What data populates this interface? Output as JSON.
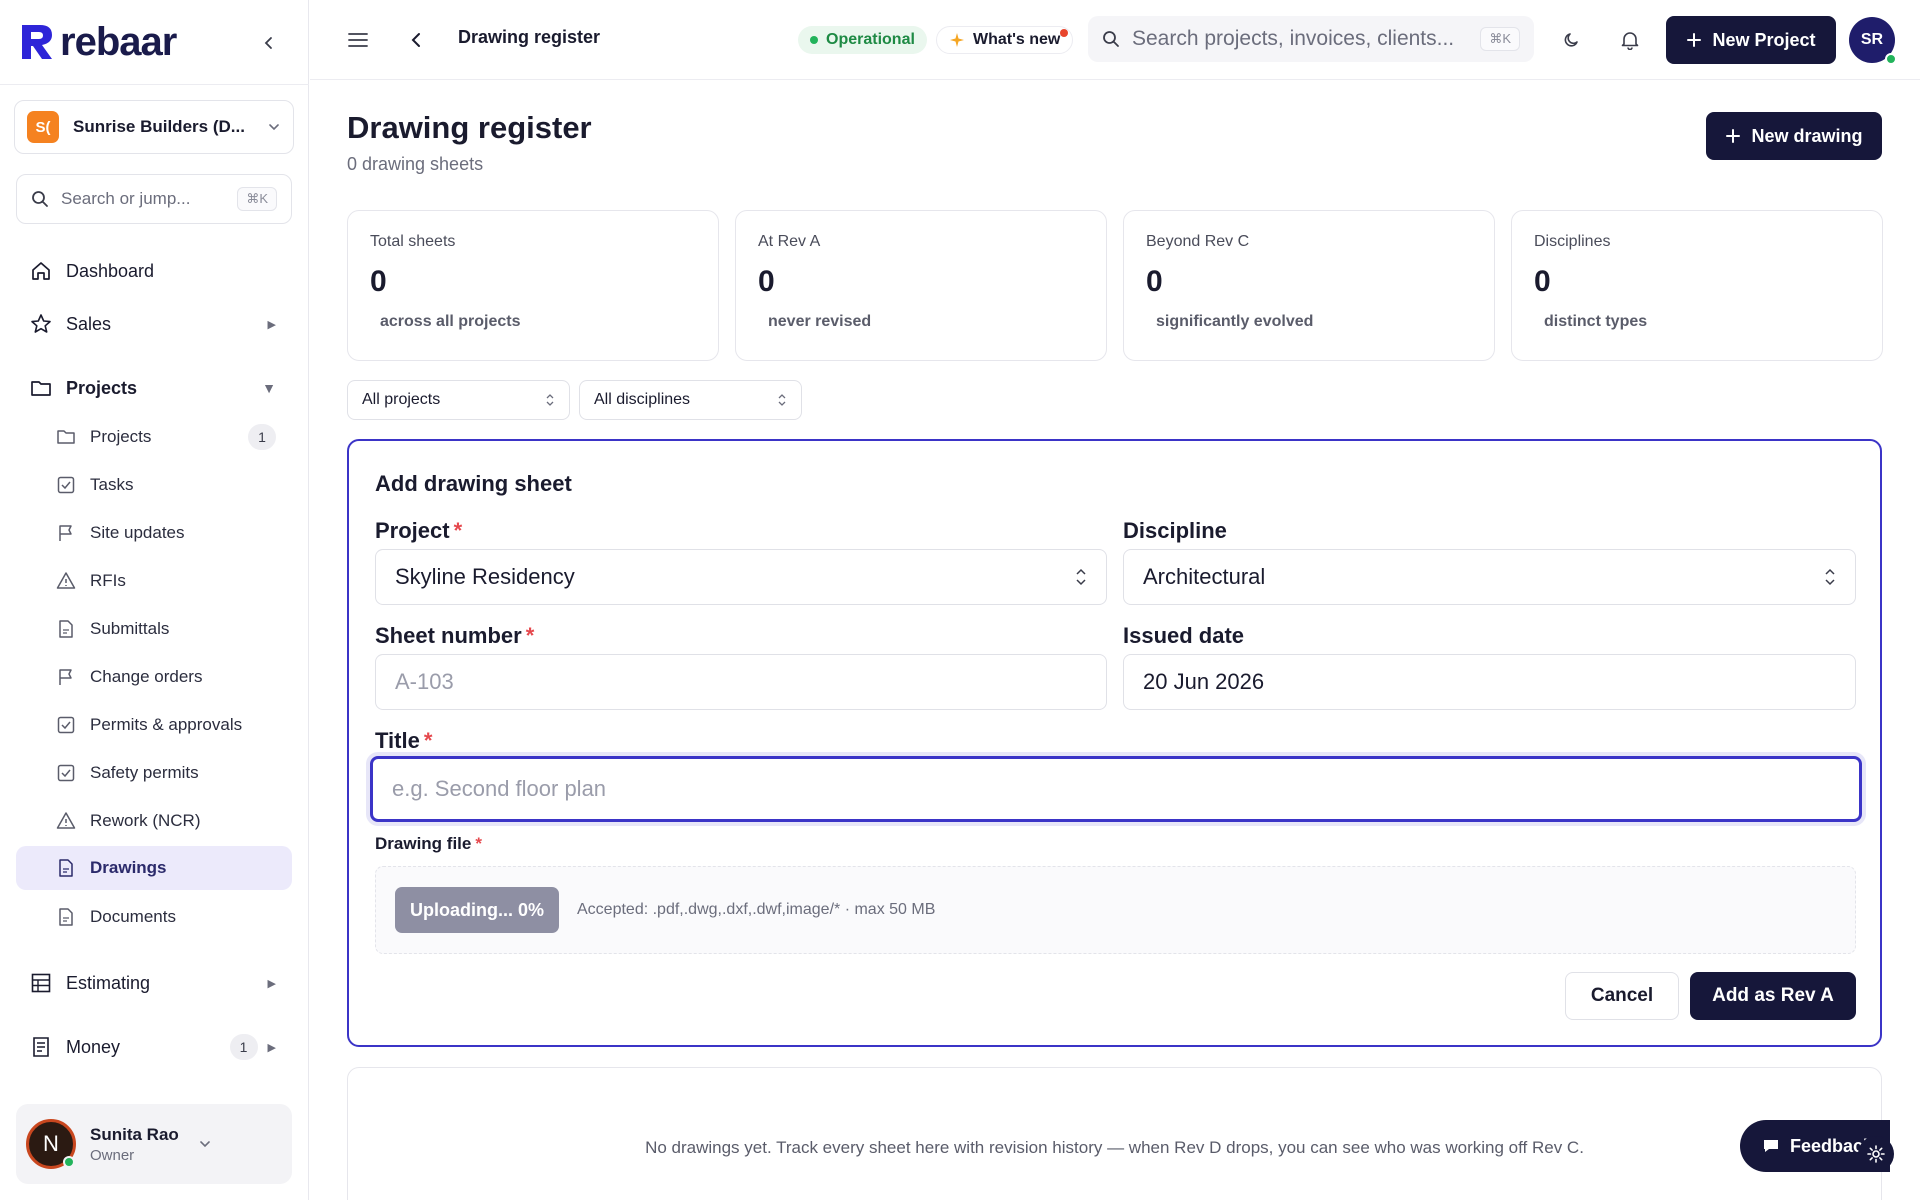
{
  "app": {
    "brand": "rebaar"
  },
  "sidebar": {
    "org": {
      "badge": "S(",
      "name": "Sunrise Builders (D..."
    },
    "search": {
      "placeholder": "Search or jump...",
      "shortcut": "⌘K"
    },
    "nav": {
      "dashboard": "Dashboard",
      "sales": "Sales",
      "projects": "Projects",
      "estimating": "Estimating",
      "money": "Money",
      "money_count": "1"
    },
    "project_items": [
      {
        "label": "Projects",
        "count": "1"
      },
      {
        "label": "Tasks"
      },
      {
        "label": "Site updates"
      },
      {
        "label": "RFIs"
      },
      {
        "label": "Submittals"
      },
      {
        "label": "Change orders"
      },
      {
        "label": "Permits & approvals"
      },
      {
        "label": "Safety permits"
      },
      {
        "label": "Rework (NCR)"
      },
      {
        "label": "Drawings"
      },
      {
        "label": "Documents"
      }
    ],
    "user": {
      "initial": "N",
      "name": "Sunita Rao",
      "role": "Owner"
    }
  },
  "header": {
    "breadcrumb": "Drawing register",
    "status": "Operational",
    "whats_new": "What's new",
    "search_placeholder": "Search projects, invoices, clients...",
    "search_shortcut": "⌘K",
    "new_project": "New Project",
    "avatar_initials": "SR"
  },
  "page": {
    "title": "Drawing register",
    "subtitle": "0 drawing sheets",
    "new_drawing": "New drawing"
  },
  "stats": [
    {
      "label": "Total sheets",
      "value": "0",
      "caption": "across all projects"
    },
    {
      "label": "At Rev A",
      "value": "0",
      "caption": "never revised"
    },
    {
      "label": "Beyond Rev C",
      "value": "0",
      "caption": "significantly evolved"
    },
    {
      "label": "Disciplines",
      "value": "0",
      "caption": "distinct types"
    }
  ],
  "filters": {
    "project": "All projects",
    "discipline": "All disciplines"
  },
  "form": {
    "title": "Add drawing sheet",
    "project_label": "Project",
    "project_value": "Skyline Residency",
    "discipline_label": "Discipline",
    "discipline_value": "Architectural",
    "sheet_label": "Sheet number",
    "sheet_placeholder": "A-103",
    "date_label": "Issued date",
    "date_value": "20 Jun 2026",
    "title_label": "Title",
    "title_placeholder": "e.g. Second floor plan",
    "file_label": "Drawing file",
    "upload_button": "Uploading... 0%",
    "accepted": "Accepted: .pdf,.dwg,.dxf,.dwf,image/* · max 50 MB",
    "required_mark": "*",
    "cancel": "Cancel",
    "submit": "Add as Rev A"
  },
  "empty": {
    "message": "No drawings yet. Track every sheet here with revision history — when Rev D drops, you can see who was working off Rev C."
  },
  "feedback": {
    "label": "Feedback"
  },
  "colors": {
    "accent": "#3b34c7",
    "dark": "#16173a",
    "brand_orange": "#f58220",
    "status_green": "#1e8a44",
    "required": "#e5484d"
  },
  "icons": [
    "rebaar-logo",
    "chevron-left-icon",
    "chevron-down-icon",
    "search-icon",
    "home-icon",
    "star-icon",
    "folder-icon",
    "check-square-icon",
    "flag-icon",
    "warning-icon",
    "document-icon",
    "grid-icon",
    "receipt-icon",
    "menu-icon",
    "sparkle-icon",
    "moon-icon",
    "bell-icon",
    "plus-icon",
    "sort-icon",
    "chat-icon",
    "gear-icon"
  ]
}
